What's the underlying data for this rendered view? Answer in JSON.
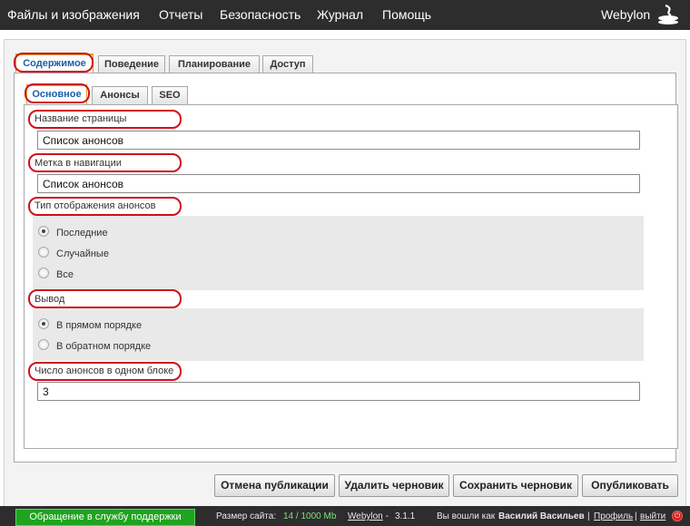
{
  "menu": {
    "items": [
      "Файлы и изображения",
      "Отчеты",
      "Безопасность",
      "Журнал",
      "Помощь"
    ],
    "logo": "Webylon"
  },
  "tabs_main": [
    "Содержимое",
    "Поведение",
    "Планирование",
    "Доступ"
  ],
  "tabs_sub": [
    "Основное",
    "Анонсы",
    "SEO"
  ],
  "fields": {
    "page_title": {
      "label": "Название страницы",
      "value": "Список анонсов"
    },
    "nav_label": {
      "label": "Метка в навигации",
      "value": "Список анонсов"
    },
    "display_type": {
      "label": "Тип отображения анонсов",
      "options": [
        "Последние",
        "Случайные",
        "Все"
      ],
      "selected": "Последние"
    },
    "order": {
      "label": "Вывод",
      "options": [
        "В прямом порядке",
        "В обратном порядке"
      ],
      "selected": "В прямом порядке"
    },
    "count": {
      "label": "Число анонсов в одном блоке",
      "value": "3"
    }
  },
  "buttons": {
    "unpublish": "Отмена публикации",
    "delete_draft": "Удалить черновик",
    "save_draft": "Сохранить черновик",
    "publish": "Опубликовать"
  },
  "status": {
    "support": "Обращение в службу поддержки",
    "site_size_label": "Размер сайта:",
    "site_size_value": "14 / 1000 Mb",
    "product": "Webylon",
    "version_sep": " - ",
    "version": "3.1.1",
    "logged_in": "Вы вошли как",
    "user": "Василий Васильев",
    "sep": "|",
    "profile": "Профиль",
    "logout": "выйти"
  },
  "colors": {
    "highlight": "#d00f1e",
    "active_tab_border": "#e6a020",
    "support_green": "#1fa41f"
  }
}
